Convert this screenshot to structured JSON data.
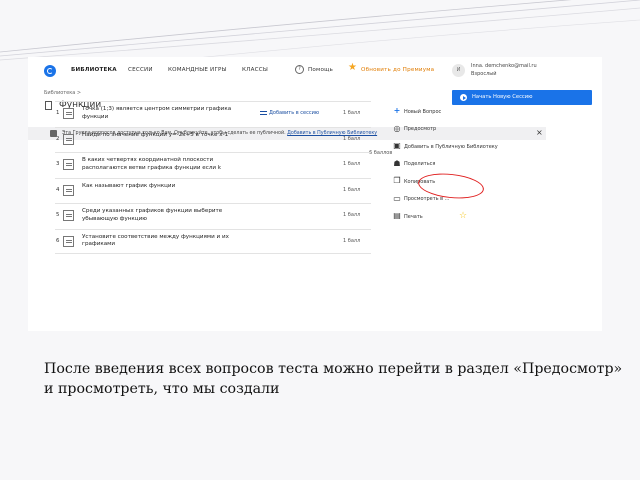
{
  "nav": {
    "items": [
      "БИБЛИОТЕКА",
      "СЕССИИ",
      "КОМАНДНЫЕ ИГРЫ",
      "КЛАССЫ"
    ],
    "help": "Помощь",
    "upgrade": "Обновить до Премиума",
    "avatar_text": "И",
    "user_email": "Inna. demchenko@mail.ru",
    "user_role": "Взрослый"
  },
  "breadcrumb": "Библиотека >",
  "title": "Функции",
  "new_session_label": "Начать Новую Сессию",
  "notice": {
    "text": "Эта Группа вопросов доступна только Вам. Опубликуйте, чтобы сделать ее публичной. ",
    "link": "Добавить в Публичную Библиотеку",
    "close": "×"
  },
  "points_total": "6 баллов",
  "questions": [
    {
      "num": "1",
      "text": "Точка (1;3) является центром симметрии графика функции",
      "add": "Добавить в сессию",
      "points": "1 балл"
    },
    {
      "num": "2",
      "text": "Найди по значение функции y=-2x+5 в точке x-1",
      "add": "",
      "points": "1 балл"
    },
    {
      "num": "3",
      "text": "В каких четвертях координатной плоскости располагаются ветви графика функции если k",
      "add": "",
      "points": "1 балл"
    },
    {
      "num": "4",
      "text": "Как называют график функции",
      "add": "",
      "points": "1 балл"
    },
    {
      "num": "5",
      "text": "Среди указанных графиков функции выберите убывающую функцию",
      "add": "",
      "points": "1 балл"
    },
    {
      "num": "6",
      "text": "Установите соответствие между функциями и их графиками",
      "add": "",
      "points": "1 балл"
    }
  ],
  "actions": [
    {
      "label": "Новый Вопрос",
      "icon": "plus-icon"
    },
    {
      "label": "Предосмотр",
      "icon": "preview-icon"
    },
    {
      "label": "Добавить в Публичную Библиотеку",
      "icon": "library-add-icon"
    },
    {
      "label": "Поделиться",
      "icon": "share-icon"
    },
    {
      "label": "Копировать",
      "icon": "copy-icon"
    },
    {
      "label": "Просмотреть в ...",
      "icon": "view-icon"
    },
    {
      "label": "Печать",
      "icon": "print-icon"
    }
  ],
  "caption": "После введения всех вопросов теста можно перейти  в раздел «Предосмотр» и просмотреть, что мы создали",
  "colors": {
    "accent": "#1a73e8",
    "highlight_ring": "#e02020",
    "upgrade": "#e07b00"
  }
}
